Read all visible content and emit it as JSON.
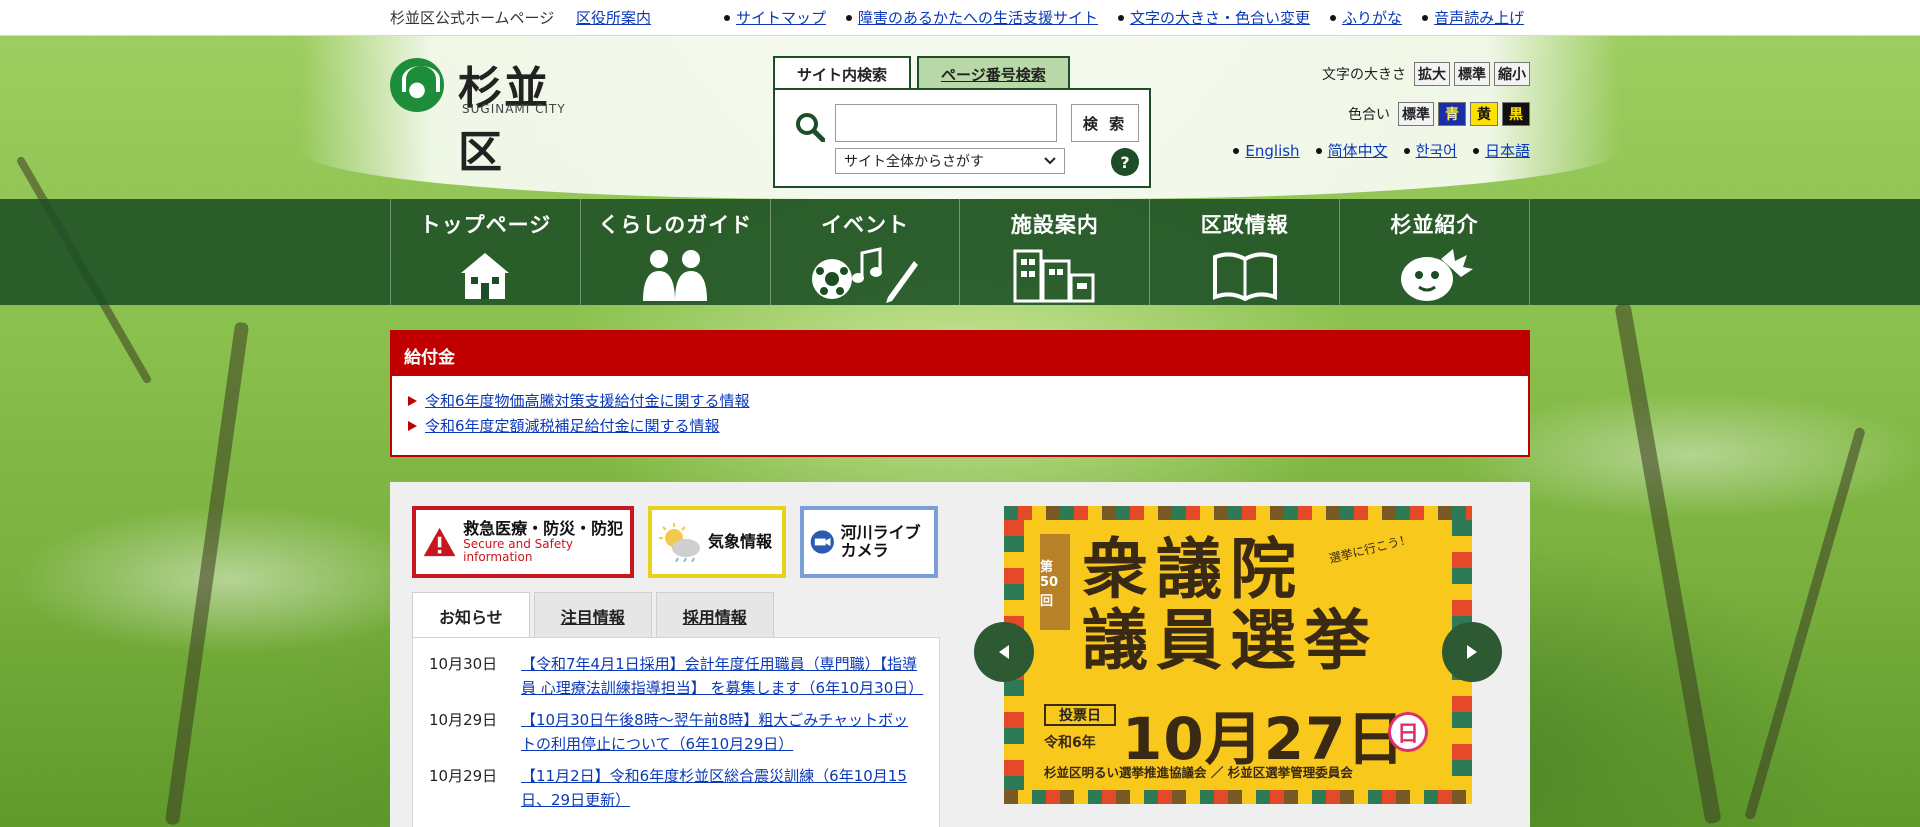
{
  "util": {
    "site_name": "杉並区公式ホームページ",
    "office_link": "区役所案内",
    "links": [
      "サイトマップ",
      "障害のあるかたへの生活支援サイト",
      "文字の大きさ・色合い変更",
      "ふりがな",
      "音声読み上げ"
    ]
  },
  "logo": {
    "name": "杉並区",
    "roman": "SUGINAMI CITY"
  },
  "search": {
    "tabs": [
      "サイト内検索",
      "ページ番号検索"
    ],
    "input_value": "",
    "button_label": "検 索",
    "scope_selected": "サイト全体からさがす",
    "help_label": "?"
  },
  "tools": {
    "text_size_label": "文字の大きさ",
    "text_size_buttons": [
      "拡大",
      "標準",
      "縮小"
    ],
    "color_label": "色合い",
    "color_buttons": [
      "標準",
      "青",
      "黄",
      "黒"
    ],
    "languages": [
      "English",
      "简体中文",
      "한국어",
      "日本語"
    ]
  },
  "nav": [
    {
      "label": "トップページ",
      "icon": "house-icon"
    },
    {
      "label": "くらしのガイド",
      "icon": "people-icon"
    },
    {
      "label": "イベント",
      "icon": "event-icon"
    },
    {
      "label": "施設案内",
      "icon": "buildings-icon"
    },
    {
      "label": "区政情報",
      "icon": "book-icon"
    },
    {
      "label": "杉並紹介",
      "icon": "mascot-icon"
    }
  ],
  "notice": {
    "title": "給付金",
    "links": [
      "令和6年度物価高騰対策支援給付金に関する情報",
      "令和6年度定額減税補足給付金に関する情報"
    ]
  },
  "banners": {
    "emergency_title": "救急医療・防災・防犯",
    "emergency_sub": "Secure and Safety information",
    "weather": "気象情報",
    "river": "河川ライブカメラ"
  },
  "news": {
    "tabs": [
      "お知らせ",
      "注目情報",
      "採用情報"
    ],
    "items": [
      {
        "date": "10月30日",
        "text": "【令和7年4月1日採用】会計年度任用職員（専門職）【指導員 心理療法訓練指導担当】 を募集します（6年10月30日）"
      },
      {
        "date": "10月29日",
        "text": "【10月30日午後8時～翌午前8時】粗大ごみチャットボットの利用停止について（6年10月29日）"
      },
      {
        "date": "10月29日",
        "text": "【11月2日】令和6年度杉並区総合震災訓練（6年10月15日、29日更新）"
      }
    ]
  },
  "slide": {
    "badge": "第50回",
    "headline_1": "衆議院",
    "headline_2": "議員選挙",
    "tagline": "選挙に行こう！",
    "vote_label": "投票日",
    "era": "令和6年",
    "date": "10月27日",
    "dow": "日",
    "footer": "杉並区明るい選挙推進協議会 ／ 杉並区選挙管理委員会"
  },
  "colors": {
    "nav_green": "#1b4e24",
    "link_blue": "#0b39b8",
    "notice_red": "#c00000",
    "slide_yellow": "#f9c81d"
  }
}
